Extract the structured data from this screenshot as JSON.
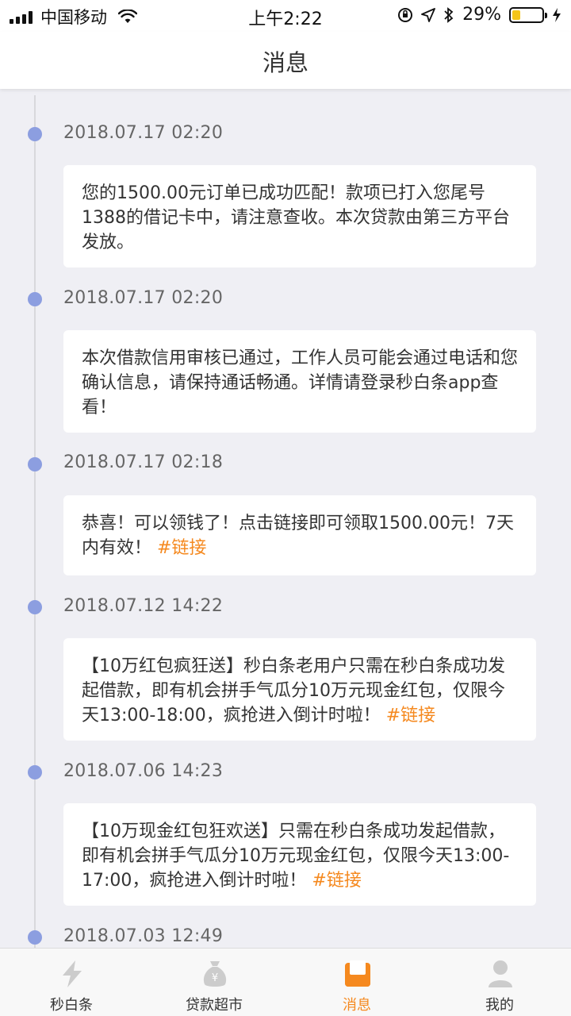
{
  "status_bar": {
    "carrier": "中国移动",
    "time": "上午2:22",
    "battery": "29%",
    "battery_level": 0.29
  },
  "nav": {
    "title": "消息"
  },
  "messages": [
    {
      "time": "2018.07.17 02:20",
      "text": "您的1500.00元订单已成功匹配！款项已打入您尾号1388的借记卡中，请注意查收。本次贷款由第三方平台发放。",
      "link": ""
    },
    {
      "time": "2018.07.17 02:20",
      "text": "本次借款信用审核已通过，工作人员可能会通过电话和您确认信息，请保持通话畅通。详情请登录秒白条app查看！",
      "link": ""
    },
    {
      "time": "2018.07.17 02:18",
      "text": "恭喜！可以领钱了！点击链接即可领取1500.00元！7天内有效！ ",
      "link": "#链接"
    },
    {
      "time": "2018.07.12 14:22",
      "text": "【10万红包疯狂送】秒白条老用户只需在秒白条成功发起借款，即有机会拼手气瓜分10万元现金红包，仅限今天13:00-18:00，疯抢进入倒计时啦！ ",
      "link": "#链接"
    },
    {
      "time": "2018.07.06 14:23",
      "text": "【10万现金红包狂欢送】只需在秒白条成功发起借款，即有机会拼手气瓜分10万元现金红包，仅限今天13:00-17:00，疯抢进入倒计时啦！ ",
      "link": "#链接"
    },
    {
      "time": "2018.07.03 12:49",
      "text": "",
      "link": ""
    }
  ],
  "tabs": [
    {
      "label": "秒白条",
      "icon": "lightning-icon"
    },
    {
      "label": "贷款超市",
      "icon": "money-bag-icon"
    },
    {
      "label": "消息",
      "icon": "message-envelope-icon",
      "active": true
    },
    {
      "label": "我的",
      "icon": "user-icon"
    }
  ],
  "colors": {
    "accent": "#f5891f",
    "timeline_dot": "#8c9ee0",
    "background": "#efeff4"
  }
}
